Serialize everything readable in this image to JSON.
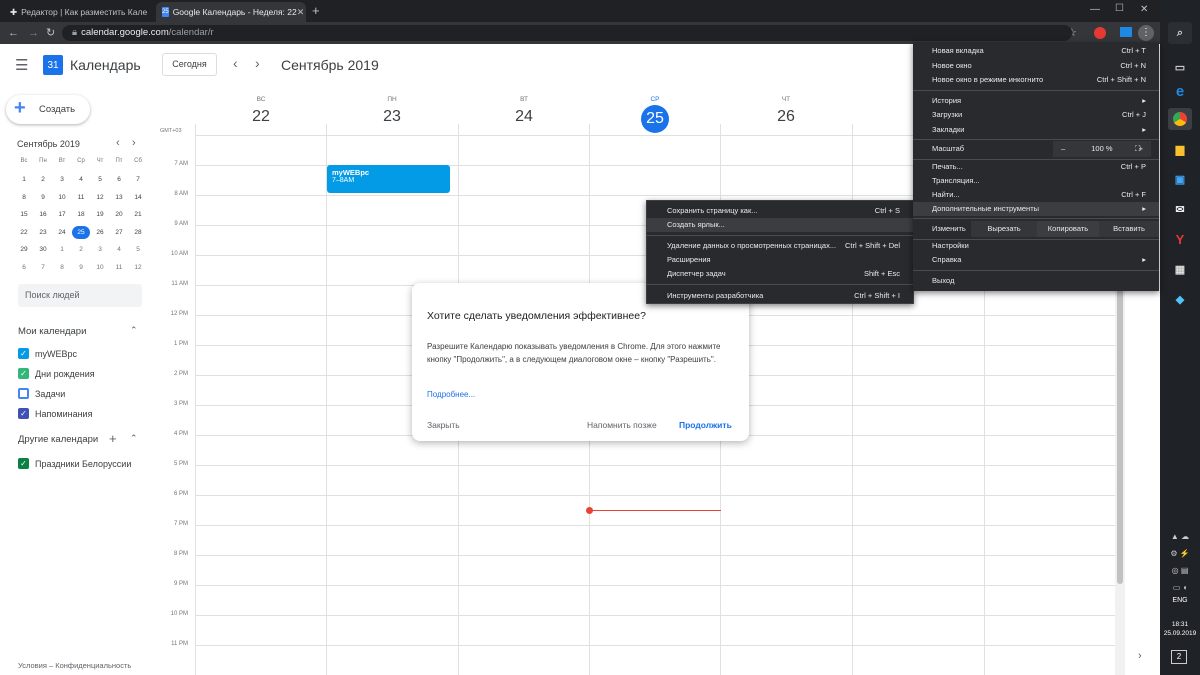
{
  "browser": {
    "tabs": [
      {
        "title": "Редактор | Как разместить Кале",
        "active": false
      },
      {
        "title": "Google Календарь - Неделя: 22",
        "active": true
      }
    ],
    "new_tab": "+",
    "url": "calendar.google.com",
    "url_path": "/calendar/r",
    "window_controls": {
      "minimize": "—",
      "maximize": "☐",
      "close": "✕"
    }
  },
  "header": {
    "app_name": "Календарь",
    "logo_day": "31",
    "today_button": "Сегодня",
    "period": "Сентябрь 2019"
  },
  "create_button": "Создать",
  "mini_calendar": {
    "title": "Сентябрь 2019",
    "weekdays": [
      "Вс",
      "Пн",
      "Вт",
      "Ср",
      "Чт",
      "Пт",
      "Сб"
    ],
    "weeks": [
      [
        "1",
        "2",
        "3",
        "4",
        "5",
        "6",
        "7"
      ],
      [
        "8",
        "9",
        "10",
        "11",
        "12",
        "13",
        "14"
      ],
      [
        "15",
        "16",
        "17",
        "18",
        "19",
        "20",
        "21"
      ],
      [
        "22",
        "23",
        "24",
        "25",
        "26",
        "27",
        "28"
      ],
      [
        "29",
        "30",
        "1",
        "2",
        "3",
        "4",
        "5"
      ],
      [
        "6",
        "7",
        "8",
        "9",
        "10",
        "11",
        "12"
      ]
    ],
    "selected": "25"
  },
  "search_people": "Поиск людей",
  "my_calendars": {
    "title": "Мои календари",
    "items": [
      {
        "label": "myWEBpc",
        "color": "#039be5",
        "checked": true
      },
      {
        "label": "Дни рождения",
        "color": "#33b679",
        "checked": true
      },
      {
        "label": "Задачи",
        "color": "#4285f4",
        "checked": false
      },
      {
        "label": "Напоминания",
        "color": "#3f51b5",
        "checked": true
      }
    ]
  },
  "other_calendars": {
    "title": "Другие календари",
    "items": [
      {
        "label": "Праздники Белоруссии",
        "color": "#0b8043",
        "checked": true
      }
    ]
  },
  "footer": "Условия – Конфиденциальность",
  "week": {
    "timezone": "GMT+03",
    "days": [
      {
        "name": "ВС",
        "num": "22"
      },
      {
        "name": "ПН",
        "num": "23"
      },
      {
        "name": "ВТ",
        "num": "24"
      },
      {
        "name": "СР",
        "num": "25"
      },
      {
        "name": "ЧТ",
        "num": "26"
      }
    ],
    "hours": [
      "7 AM",
      "8 AM",
      "9 AM",
      "10 AM",
      "11 AM",
      "12 PM",
      "1 PM",
      "2 PM",
      "3 PM",
      "4 PM",
      "5 PM",
      "6 PM",
      "7 PM",
      "8 PM",
      "9 PM",
      "10 PM",
      "11 PM"
    ]
  },
  "event": {
    "title": "myWEBpc",
    "time": "7–8AM",
    "color": "#039be5"
  },
  "dialog": {
    "title": "Хотите сделать уведомления эффективнее?",
    "body": "Разрешите Календарю показывать уведомления в Chrome. Для этого нажмите кнопку \"Продолжить\", а в следующем диалоговом окне – кнопку \"Разрешить\".",
    "more_link": "Подробнее...",
    "close": "Закрыть",
    "remind": "Напомнить позже",
    "continue": "Продолжить"
  },
  "chrome_menu": {
    "new_tab": {
      "label": "Новая вкладка",
      "sc": "Ctrl + T"
    },
    "new_window": {
      "label": "Новое окно",
      "sc": "Ctrl + N"
    },
    "incognito": {
      "label": "Новое окно в режиме инкогнито",
      "sc": "Ctrl + Shift + N"
    },
    "history": {
      "label": "История"
    },
    "downloads": {
      "label": "Загрузки",
      "sc": "Ctrl + J"
    },
    "bookmarks": {
      "label": "Закладки"
    },
    "zoom": {
      "label": "Масштаб",
      "minus": "–",
      "value": "100 %",
      "plus": "+"
    },
    "print": {
      "label": "Печать...",
      "sc": "Ctrl + P"
    },
    "cast": {
      "label": "Трансляция..."
    },
    "find": {
      "label": "Найти...",
      "sc": "Ctrl + F"
    },
    "more_tools": {
      "label": "Дополнительные инструменты"
    },
    "edit": {
      "label": "Изменить",
      "cut": "Вырезать",
      "copy": "Копировать",
      "paste": "Вставить"
    },
    "settings": {
      "label": "Настройки"
    },
    "help": {
      "label": "Справка"
    },
    "exit": {
      "label": "Выход"
    }
  },
  "submenu": {
    "save_page": {
      "label": "Сохранить страницу как...",
      "sc": "Ctrl + S"
    },
    "create_shortcut": {
      "label": "Создать ярлык..."
    },
    "clear_data": {
      "label": "Удаление данных о просмотренных страницах...",
      "sc": "Ctrl + Shift + Del"
    },
    "extensions": {
      "label": "Расширения"
    },
    "task_manager": {
      "label": "Диспетчер задач",
      "sc": "Shift + Esc"
    },
    "dev_tools": {
      "label": "Инструменты разработчика",
      "sc": "Ctrl + Shift + I"
    }
  },
  "taskbar": {
    "lang": "ENG",
    "time": "18:31",
    "date": "25.09.2019",
    "notif_count": "2"
  }
}
